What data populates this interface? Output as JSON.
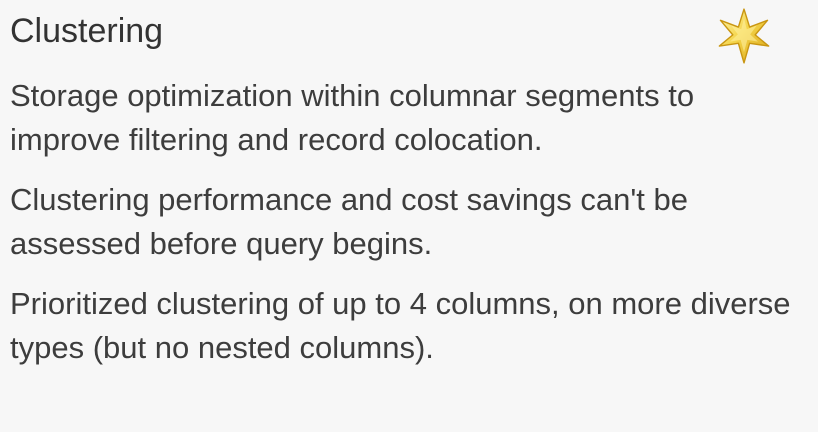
{
  "card": {
    "title": "Clustering",
    "icon": "star-icon",
    "paragraphs": [
      "Storage optimization within columnar segments to improve filtering and record colocation.",
      "Clustering performance and cost savings can't be assessed before query begins.",
      "Prioritized clustering of up to 4 columns, on more diverse types (but no nested columns)."
    ],
    "colors": {
      "background": "#f7f7f7",
      "text": "#3d3d3d",
      "star_fill": "#f4d44a",
      "star_stroke": "#d2a21f"
    }
  }
}
